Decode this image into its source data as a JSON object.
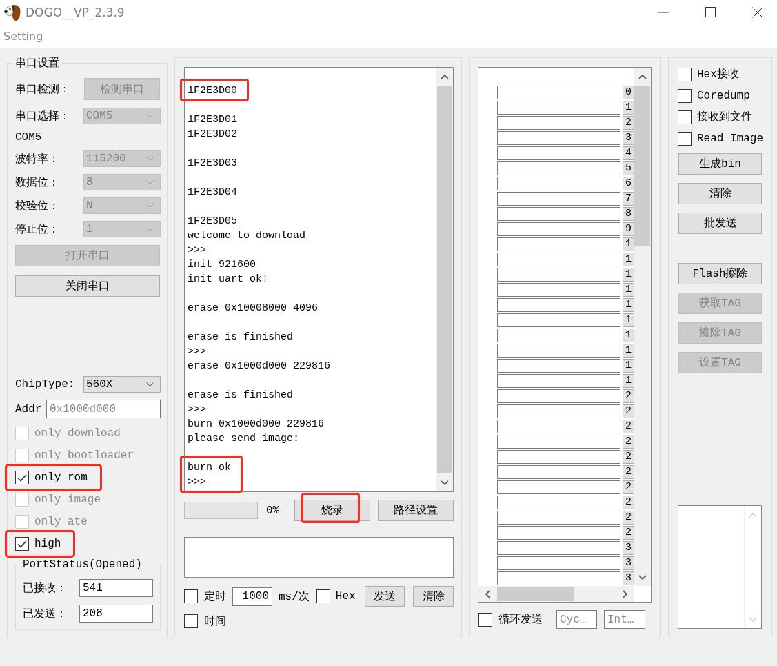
{
  "window": {
    "title": "DOGO__VP_2.3.9"
  },
  "menu": [
    {
      "label": "Setting"
    }
  ],
  "serial": {
    "title": "串口设置",
    "rows": [
      {
        "kind": "button",
        "label": "串口检测：",
        "value": "检测串口",
        "disabled": true
      },
      {
        "kind": "select",
        "label": "串口选择：",
        "value": "COM5",
        "disabled": true
      },
      {
        "kind": "text",
        "label": "COM5"
      },
      {
        "kind": "select",
        "label": "波特率：",
        "value": "115200",
        "disabled": true
      },
      {
        "kind": "select",
        "label": "数据位：",
        "value": "8",
        "disabled": true
      },
      {
        "kind": "select",
        "label": "校验位：",
        "value": "N",
        "disabled": true
      },
      {
        "kind": "select",
        "label": "停止位：",
        "value": "1",
        "disabled": true
      }
    ],
    "buttons": [
      {
        "label": "打开串口",
        "disabled": true
      },
      {
        "label": "关闭串口",
        "disabled": false
      }
    ],
    "chip_type": {
      "label": "ChipType:",
      "value": "560X",
      "disabled": false
    },
    "addr": {
      "label": "Addr",
      "placeholder": "0x1000d000"
    },
    "options": [
      {
        "label": "only download",
        "checked": false,
        "disabled": true,
        "highlighted": false
      },
      {
        "label": "only bootloader",
        "checked": false,
        "disabled": true,
        "highlighted": false
      },
      {
        "label": "only rom",
        "checked": true,
        "disabled": false,
        "highlighted": true
      },
      {
        "label": "only image",
        "checked": false,
        "disabled": true,
        "highlighted": false
      },
      {
        "label": "only ate",
        "checked": false,
        "disabled": true,
        "highlighted": false
      },
      {
        "label": "high",
        "checked": true,
        "disabled": false,
        "highlighted": true
      }
    ],
    "port_status": {
      "title": "PortStatus(Opened)",
      "fields": [
        {
          "label": "已接收：",
          "value": "541"
        },
        {
          "label": "已发送：",
          "value": "208"
        }
      ]
    }
  },
  "log": {
    "blocks": [
      {
        "lines": [
          "1F2E3D00"
        ],
        "highlighted": true
      },
      {
        "lines": [
          "1F2E3D01",
          "1F2E3D02"
        ],
        "highlighted": false
      },
      {
        "lines": [
          "1F2E3D03"
        ],
        "highlighted": false
      },
      {
        "lines": [
          "1F2E3D04"
        ],
        "highlighted": false
      },
      {
        "lines": [
          "1F2E3D05",
          "welcome to download",
          ">>>",
          "init 921600",
          "init uart ok!"
        ],
        "highlighted": false
      },
      {
        "lines": [
          "erase 0x10008000 4096"
        ],
        "highlighted": false
      },
      {
        "lines": [
          "erase is finished",
          ">>>",
          "erase 0x1000d000 229816"
        ],
        "highlighted": false
      },
      {
        "lines": [
          "erase is finished",
          ">>>",
          "burn 0x1000d000 229816",
          "please send image:"
        ],
        "highlighted": false
      },
      {
        "lines": [
          "burn ok",
          ">>>"
        ],
        "highlighted": true
      }
    ]
  },
  "burn": {
    "progress": {
      "level": 0,
      "reading": "0%"
    },
    "buttons": [
      {
        "label": "烧录",
        "highlighted": true
      },
      {
        "label": "路径设置",
        "highlighted": false
      }
    ]
  },
  "send": {
    "timer": {
      "label": "定时",
      "checked": false
    },
    "interval": "1000",
    "unit": "ms/次",
    "hex": {
      "label": "Hex",
      "checked": false
    },
    "buttons": [
      {
        "label": "发送"
      },
      {
        "label": "清除"
      }
    ],
    "time": {
      "label": "时间",
      "checked": false
    }
  },
  "multi_send": {
    "rows": [
      "0",
      "1",
      "2",
      "3",
      "4",
      "5",
      "6",
      "7",
      "8",
      "9",
      "1",
      "1",
      "1",
      "1",
      "1",
      "1",
      "1",
      "1",
      "1",
      "1",
      "2",
      "2",
      "2",
      "2",
      "2",
      "2",
      "2",
      "2",
      "2",
      "2",
      "3",
      "3",
      "3"
    ],
    "loop": {
      "label": "循环发送",
      "checked": false
    },
    "fields": [
      {
        "placeholder": "Cyc…"
      },
      {
        "placeholder": "Int…"
      }
    ]
  },
  "tools": {
    "options": [
      {
        "label": "Hex接收",
        "checked": false
      },
      {
        "label": "Coredump",
        "checked": false
      },
      {
        "label": "接收到文件",
        "checked": false
      },
      {
        "label": "Read Image",
        "checked": false
      }
    ],
    "button_groups": [
      [
        {
          "label": "生成bin",
          "disabled": false
        },
        {
          "label": "清除",
          "disabled": false
        },
        {
          "label": "批发送",
          "disabled": false
        }
      ],
      [
        {
          "label": "Flash擦除",
          "disabled": false
        },
        {
          "label": "获取TAG",
          "disabled": true
        },
        {
          "label": "擦除TAG",
          "disabled": true
        },
        {
          "label": "设置TAG",
          "disabled": true
        }
      ]
    ]
  }
}
